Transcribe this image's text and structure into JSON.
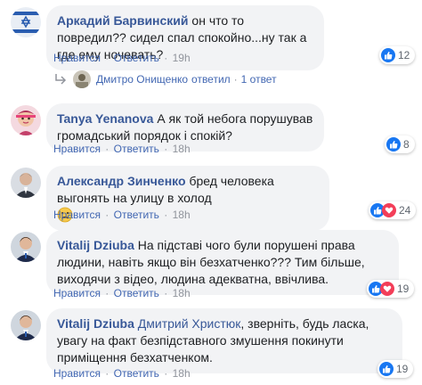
{
  "colors": {
    "link": "#385898",
    "action": "#4267b2",
    "muted": "#90949c",
    "bubble": "#f2f3f5",
    "like": "#1877f2",
    "love": "#f33e58"
  },
  "actions": {
    "like_label": "Нравится",
    "reply_label": "Ответить",
    "separator": "·"
  },
  "comments": [
    {
      "author": "Аркадий Барвинский",
      "text": "он что то повредил?? сидел спал спокойно...ну так а где ему ночевать?",
      "time": "19h",
      "reactions": [
        "like"
      ],
      "reaction_count": "12",
      "avatar_icon": "flag-avatar"
    },
    {
      "author": "Tanya Yenanova",
      "text": "А як той небога порушував громадський порядок і спокій?",
      "time": "18h",
      "reactions": [
        "like"
      ],
      "reaction_count": "8",
      "avatar_icon": "woman-avatar"
    },
    {
      "author": "Александр Зинченко",
      "text": "бред человека выгонять на улицу в холод",
      "emoji": "sad-face-icon",
      "time": "18h",
      "reactions": [
        "like",
        "love"
      ],
      "reaction_count": "24",
      "avatar_icon": "man-avatar"
    },
    {
      "author": "Vitalij Dziuba",
      "text": "На підставі чого були порушені права людини, навіть якщо він безхатченко??? Тим більше, виходячи з відео, людина адекватна, ввічлива.",
      "time": "18h",
      "reactions": [
        "like",
        "love"
      ],
      "reaction_count": "19",
      "avatar_icon": "man-avatar"
    },
    {
      "author": "Vitalij Dziuba",
      "mention": "Дмитрий Христюк",
      "text": ", зверніть, будь ласка, увагу на факт безпідставного змушення покинути приміщення безхатченком.",
      "time": "18h",
      "reactions": [
        "like"
      ],
      "reaction_count": "19",
      "avatar_icon": "man-avatar"
    }
  ],
  "reply_summary": {
    "name": "Дмитро Онищенко",
    "verb": "ответил",
    "count": "1 ответ"
  }
}
